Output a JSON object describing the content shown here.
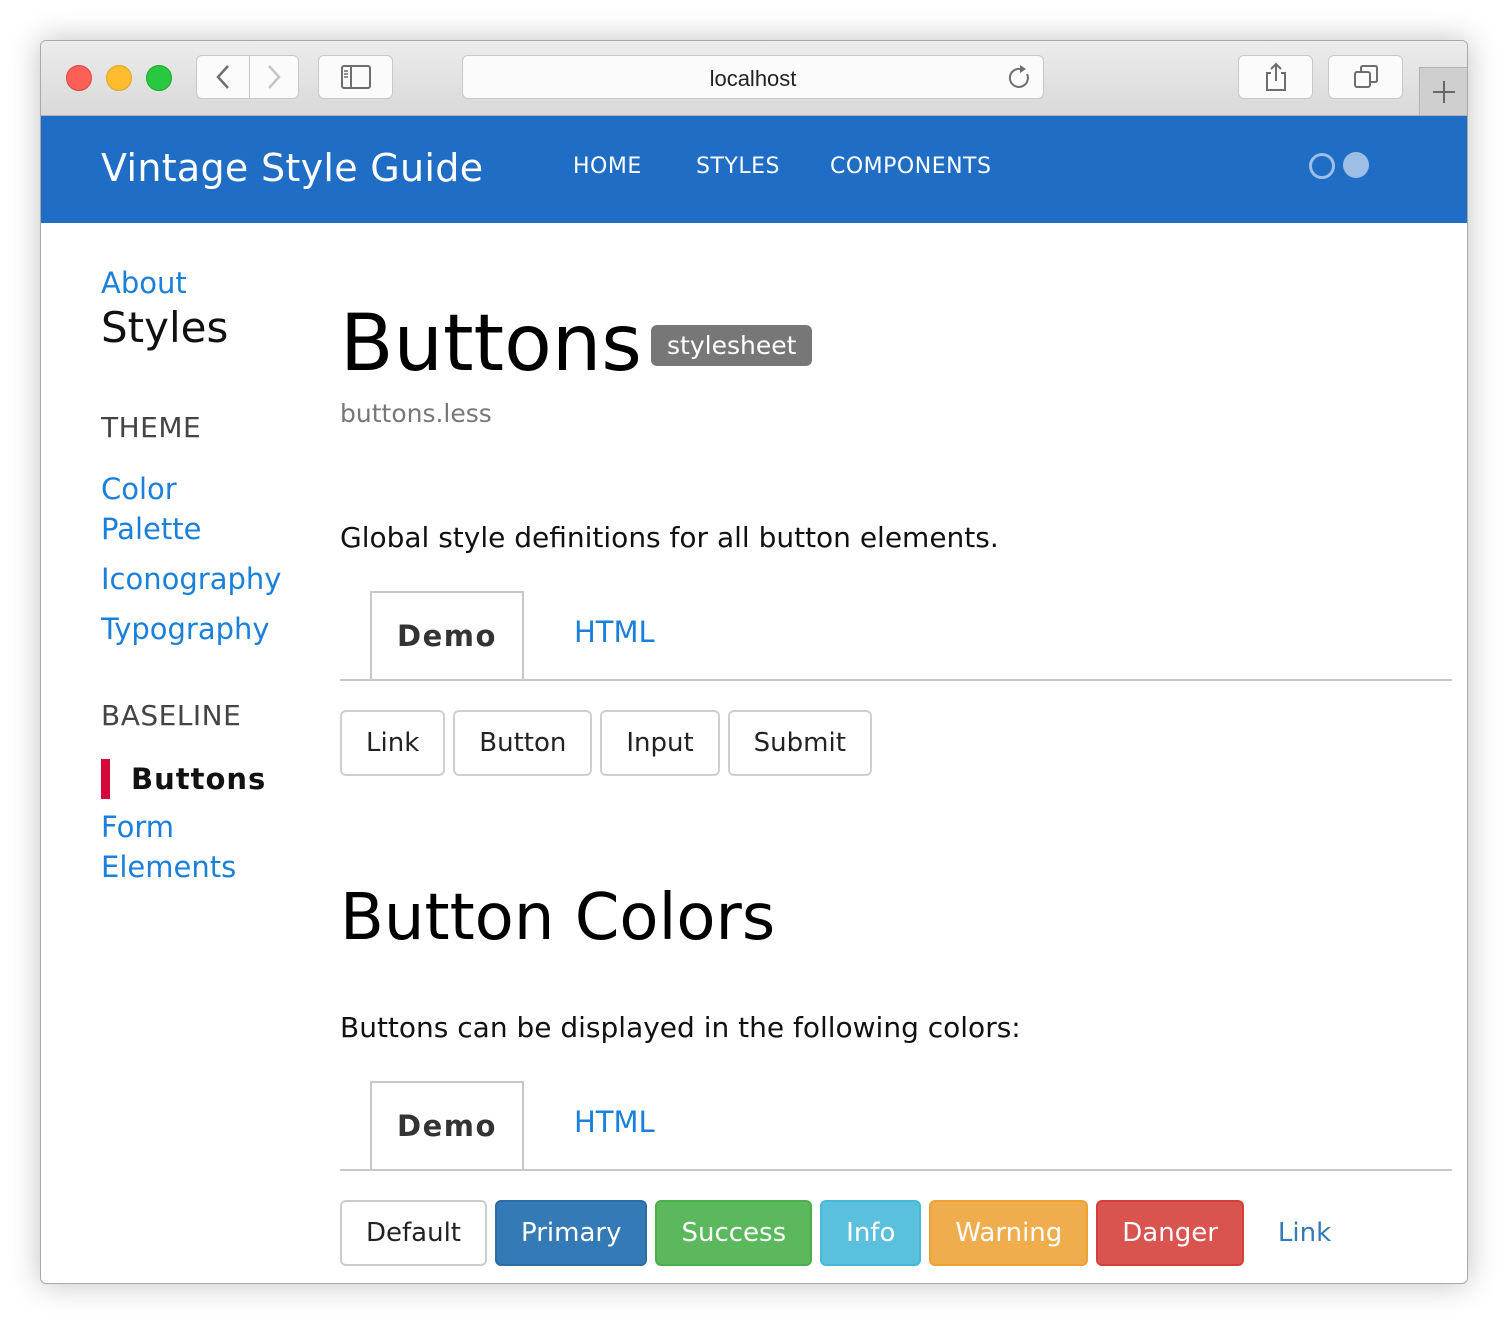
{
  "browser": {
    "url": "localhost",
    "icons": [
      "back-icon",
      "forward-icon",
      "sidebar-icon",
      "reload-icon",
      "share-icon",
      "tabs-icon",
      "new-tab-icon"
    ]
  },
  "navbar": {
    "brand": "Vintage Style Guide",
    "links": [
      "HOME",
      "STYLES",
      "COMPONENTS"
    ],
    "color": "#1f6dc4"
  },
  "sidebar": {
    "about": "About",
    "current_section": "Styles",
    "theme_heading": "THEME",
    "theme_items": [
      "Color Palette",
      "Iconography",
      "Typography"
    ],
    "baseline_heading": "BASELINE",
    "baseline_active": "Buttons",
    "baseline_items": [
      "Form Elements"
    ],
    "active_color": "#d3093b"
  },
  "main": {
    "title": "Buttons",
    "badge": "stylesheet",
    "file": "buttons.less",
    "description": "Global style definitions for all button elements.",
    "tabs1": {
      "demo": "Demo",
      "html": "HTML"
    },
    "buttons": [
      "Link",
      "Button",
      "Input",
      "Submit"
    ],
    "colors_title": "Button Colors",
    "colors_description": "Buttons can be displayed in the following colors:",
    "tabs2": {
      "demo": "Demo",
      "html": "HTML"
    },
    "color_buttons": [
      {
        "label": "Default",
        "bg": "#ffffff",
        "fg": "#222222",
        "border": "#cccccc"
      },
      {
        "label": "Primary",
        "bg": "#337ab7",
        "fg": "#ffffff",
        "border": "#2e6da4"
      },
      {
        "label": "Success",
        "bg": "#5cb85c",
        "fg": "#ffffff",
        "border": "#4cae4c"
      },
      {
        "label": "Info",
        "bg": "#5bc0de",
        "fg": "#ffffff",
        "border": "#46b8da"
      },
      {
        "label": "Warning",
        "bg": "#f0ad4e",
        "fg": "#ffffff",
        "border": "#eea236"
      },
      {
        "label": "Danger",
        "bg": "#d9534f",
        "fg": "#ffffff",
        "border": "#d43f3a"
      },
      {
        "label": "Link",
        "bg": "transparent",
        "fg": "#337ab7",
        "border": "transparent"
      }
    ]
  }
}
